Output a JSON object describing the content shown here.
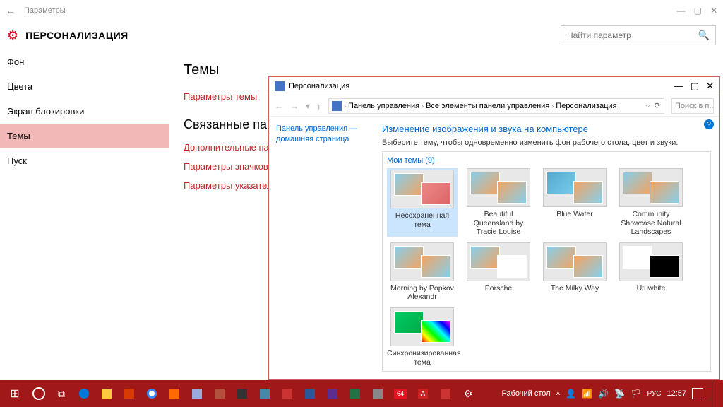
{
  "window": {
    "title": "Параметры",
    "back_icon": "arrow-left"
  },
  "page": {
    "title": "ПЕРСОНАЛИЗАЦИЯ"
  },
  "search": {
    "placeholder": "Найти параметр"
  },
  "sidebar": {
    "items": [
      {
        "label": "Фон",
        "active": false
      },
      {
        "label": "Цвета",
        "active": false
      },
      {
        "label": "Экран блокировки",
        "active": false
      },
      {
        "label": "Темы",
        "active": true
      },
      {
        "label": "Пуск",
        "active": false
      }
    ]
  },
  "main": {
    "section1": {
      "heading": "Темы",
      "link1": "Параметры темы"
    },
    "section2": {
      "heading": "Связанные параметры",
      "link1": "Дополнительные параметры",
      "link2": "Параметры значков рабочего стола",
      "link3": "Параметры указателя мыши"
    }
  },
  "cp": {
    "title": "Персонализация",
    "breadcrumb": [
      "Панель управления",
      "Все элементы панели управления",
      "Персонализация"
    ],
    "search_placeholder": "Поиск в п...",
    "sidebar_link": "Панель управления — домашняя страница",
    "heading": "Изменение изображения и звука на компьютере",
    "subtext": "Выберите тему, чтобы одновременно изменить фон рабочего стола, цвет и звуки.",
    "group": "Мои темы (9)",
    "themes": [
      {
        "name": "Несохраненная тема",
        "selected": true
      },
      {
        "name": "Beautiful Queensland by Tracie Louise"
      },
      {
        "name": "Blue Water"
      },
      {
        "name": "Community Showcase Natural Landscapes"
      },
      {
        "name": "Morning by Popkov Alexandr"
      },
      {
        "name": "Porsche"
      },
      {
        "name": "The Milky Way"
      },
      {
        "name": "Utuwhite"
      },
      {
        "name": "Синхронизированная тема"
      }
    ]
  },
  "taskbar": {
    "desktop_label": "Рабочий стол",
    "lang": "РУС",
    "clock": "12:57",
    "up_icon": "chevron-up"
  }
}
